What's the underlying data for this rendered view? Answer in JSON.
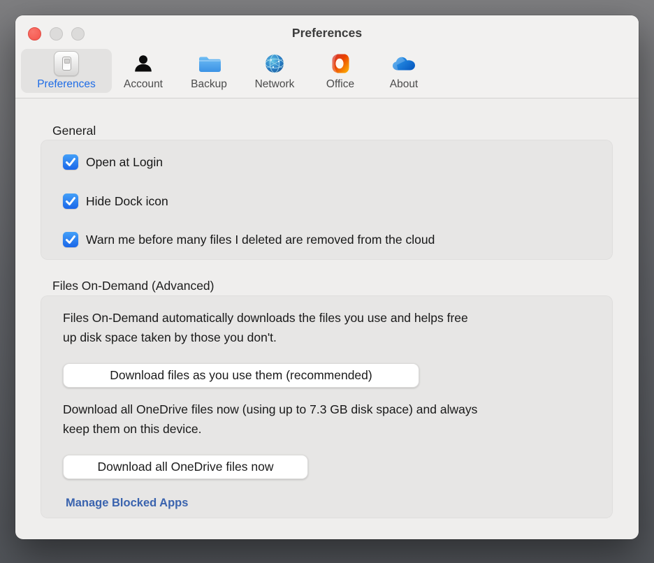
{
  "window": {
    "title": "Preferences"
  },
  "toolbar": {
    "tabs": [
      {
        "label": "Preferences",
        "icon": "preferences-switch-icon",
        "selected": true
      },
      {
        "label": "Account",
        "icon": "person-icon",
        "selected": false
      },
      {
        "label": "Backup",
        "icon": "folder-icon",
        "selected": false
      },
      {
        "label": "Network",
        "icon": "globe-icon",
        "selected": false
      },
      {
        "label": "Office",
        "icon": "office-icon",
        "selected": false
      },
      {
        "label": "About",
        "icon": "onedrive-cloud-icon",
        "selected": false
      }
    ]
  },
  "general": {
    "heading": "General",
    "checkboxes": [
      {
        "label": "Open at Login",
        "checked": true
      },
      {
        "label": "Hide Dock icon",
        "checked": true
      },
      {
        "label": "Warn me before many files I deleted are removed from the cloud",
        "checked": true
      }
    ]
  },
  "files_on_demand": {
    "heading": "Files On-Demand (Advanced)",
    "description_lines": [
      "Files On-Demand automatically downloads the files you use and helps free",
      "up disk space taken by those you don't."
    ],
    "download_recommended_button": "Download files as you use them (recommended)",
    "download_all_lines": [
      "Download all OneDrive files now (using up to 7.3 GB disk space) and always",
      "keep them on this device."
    ],
    "download_all_button": "Download all OneDrive files now",
    "manage_blocked_apps_link": "Manage Blocked Apps"
  },
  "colors": {
    "accent_blue": "#1e6ce6",
    "checkbox_blue": "#1a66e9",
    "link_blue": "#3a63ae",
    "close_button_red": "#f5544b",
    "window_background": "#efeeed",
    "groupbox_background": "#e7e6e5"
  }
}
